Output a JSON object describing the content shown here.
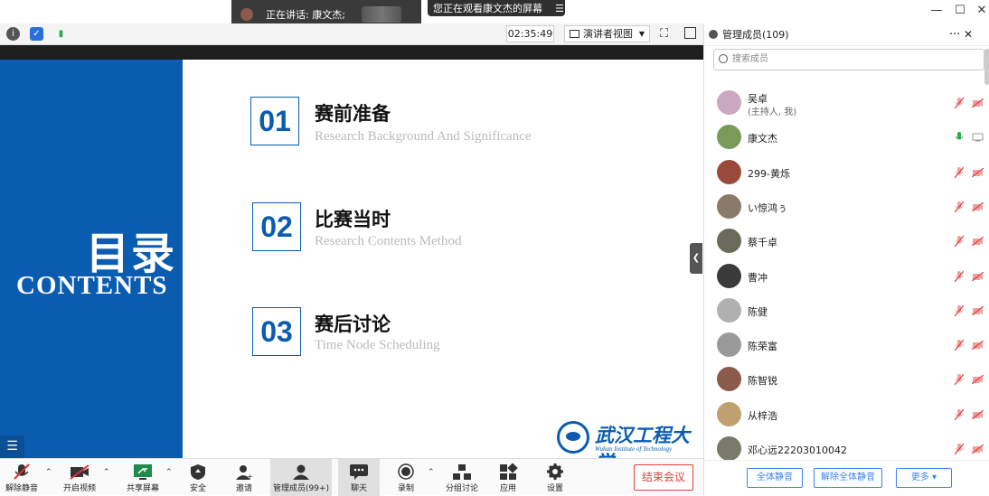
{
  "overlay": {
    "speaking_label": "正在讲话: 康文杰;",
    "viewing_label": "您正在观看康文杰的屏幕",
    "viewing_menu_icon": "menu-icon"
  },
  "window_controls": {
    "minimize": "—",
    "maximize": "☐",
    "close": "✕"
  },
  "meeting_toolbar": {
    "timer": "02:35:49",
    "view_mode": "演讲者视图",
    "icons": [
      "info-icon",
      "shield-icon",
      "signal-icon",
      "fullscreen-icon",
      "sidebar-icon"
    ]
  },
  "slide": {
    "title_cn": "目录",
    "title_en": "CONTENTS",
    "items": [
      {
        "num": "01",
        "title": "赛前准备",
        "subtitle": "Research Background And Significance"
      },
      {
        "num": "02",
        "title": "比赛当时",
        "subtitle": "Research Contents Method"
      },
      {
        "num": "03",
        "title": "赛后讨论",
        "subtitle": "Time Node  Scheduling"
      }
    ],
    "logo_cn": "武汉工程大学",
    "logo_en": "Wuhan Institute of Technology",
    "colors": {
      "primary": "#0a5cb0"
    }
  },
  "bottom_toolbar": {
    "items": [
      {
        "label": "解除静音",
        "icon": "mic-muted-icon"
      },
      {
        "label": "开启视频",
        "icon": "video-off-icon"
      },
      {
        "label": "共享屏幕",
        "icon": "share-screen-icon"
      },
      {
        "label": "安全",
        "icon": "security-icon"
      },
      {
        "label": "邀请",
        "icon": "invite-icon"
      },
      {
        "label": "管理成员(99+)",
        "icon": "members-icon"
      },
      {
        "label": "聊天",
        "icon": "chat-icon"
      },
      {
        "label": "录制",
        "icon": "record-icon"
      },
      {
        "label": "分组讨论",
        "icon": "breakout-icon"
      },
      {
        "label": "应用",
        "icon": "apps-icon"
      },
      {
        "label": "设置",
        "icon": "settings-icon"
      }
    ],
    "end_meeting": "结束会议"
  },
  "panel": {
    "title": "管理成员(109)",
    "more": "···",
    "close": "✕",
    "search_placeholder": "搜索成员",
    "members": [
      {
        "name": "吴卓",
        "note": "(主持人, 我)",
        "mic": "muted",
        "avatar_color": "#c9a8c0"
      },
      {
        "name": "康文杰",
        "note": "",
        "mic": "active",
        "avatar_color": "#7a9a5a"
      },
      {
        "name": "299-黄烁",
        "note": "",
        "mic": "muted",
        "avatar_color": "#9a4a3a"
      },
      {
        "name": "い惊鸿ぅ",
        "note": "",
        "mic": "muted",
        "avatar_color": "#8a7a6a"
      },
      {
        "name": "蔡千卓",
        "note": "",
        "mic": "muted",
        "avatar_color": "#6a6a5a"
      },
      {
        "name": "曹冲",
        "note": "",
        "mic": "muted",
        "avatar_color": "#3a3a3a"
      },
      {
        "name": "陈健",
        "note": "",
        "mic": "muted",
        "avatar_color": "#b0b0b0"
      },
      {
        "name": "陈荣富",
        "note": "",
        "mic": "muted",
        "avatar_color": "#9a9a9a"
      },
      {
        "name": "陈智锐",
        "note": "",
        "mic": "muted",
        "avatar_color": "#8a5a4a"
      },
      {
        "name": "从梓浩",
        "note": "",
        "mic": "muted",
        "avatar_color": "#c0a070"
      },
      {
        "name": "邓心远22203010042",
        "note": "",
        "mic": "muted",
        "avatar_color": "#7a7a6a"
      }
    ],
    "footer": {
      "mute_all": "全体静音",
      "unmute_all": "解除全体静音",
      "more": "更多 ▾"
    }
  }
}
